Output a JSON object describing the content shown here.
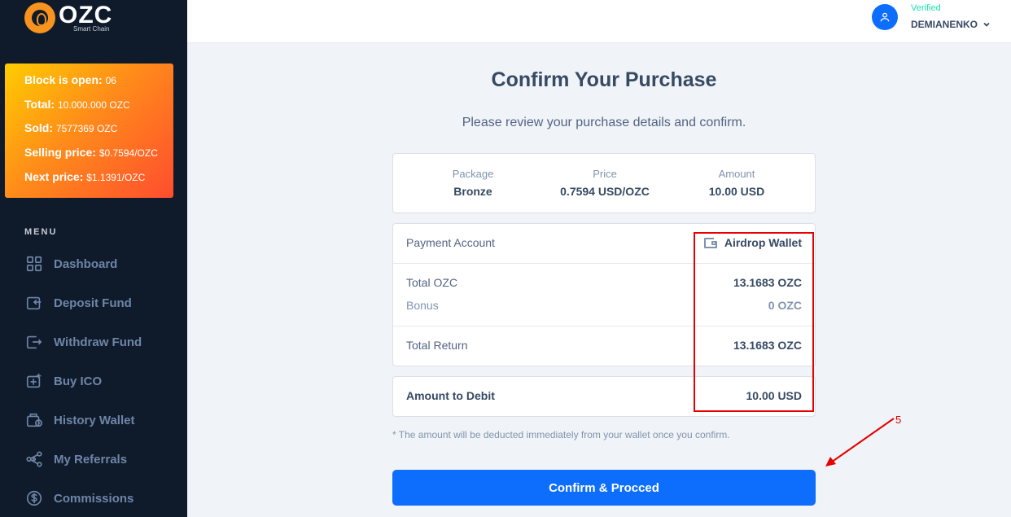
{
  "brand": {
    "name": "OZC",
    "tagline": "Smart Chain"
  },
  "block": {
    "open_label": "Block is open:",
    "open_value": "06",
    "total_label": "Total:",
    "total_value": "10.000.000 OZC",
    "sold_label": "Sold:",
    "sold_value": "7577369 OZC",
    "selling_label": "Selling price:",
    "selling_value": "$0.7594/OZC",
    "next_label": "Next price:",
    "next_value": "$1.1391/OZC"
  },
  "menu": {
    "title": "MENU",
    "items": [
      {
        "label": "Dashboard",
        "icon": "grid-icon"
      },
      {
        "label": "Deposit Fund",
        "icon": "deposit-icon"
      },
      {
        "label": "Withdraw Fund",
        "icon": "withdraw-icon"
      },
      {
        "label": "Buy ICO",
        "icon": "buy-icon"
      },
      {
        "label": "History Wallet",
        "icon": "wallet-icon"
      },
      {
        "label": "My Referrals",
        "icon": "share-icon"
      },
      {
        "label": "Commissions",
        "icon": "dollar-icon"
      }
    ]
  },
  "user": {
    "status": "Verified",
    "name": "DEMIANENKO"
  },
  "page": {
    "title": "Confirm Your Purchase",
    "subtitle": "Please review your purchase details and confirm."
  },
  "package": {
    "package_label": "Package",
    "package_value": "Bronze",
    "price_label": "Price",
    "price_value": "0.7594 USD/OZC",
    "amount_label": "Amount",
    "amount_value": "10.00 USD"
  },
  "details": {
    "payment_account_label": "Payment Account",
    "payment_account_value": "Airdrop Wallet",
    "total_ozc_label": "Total OZC",
    "total_ozc_value": "13.1683 OZC",
    "bonus_label": "Bonus",
    "bonus_value": "0 OZC",
    "total_return_label": "Total Return",
    "total_return_value": "13.1683 OZC",
    "debit_label": "Amount to Debit",
    "debit_value": "10.00 USD"
  },
  "note": "* The amount will be deducted immediately from your wallet once you confirm.",
  "confirm_label": "Confirm & Procced",
  "annotation": {
    "number": "5",
    "color": "#e60000"
  },
  "colors": {
    "accent": "#0d6efd",
    "sidebar": "#0f1b2b",
    "verified": "#1ee0ac"
  }
}
